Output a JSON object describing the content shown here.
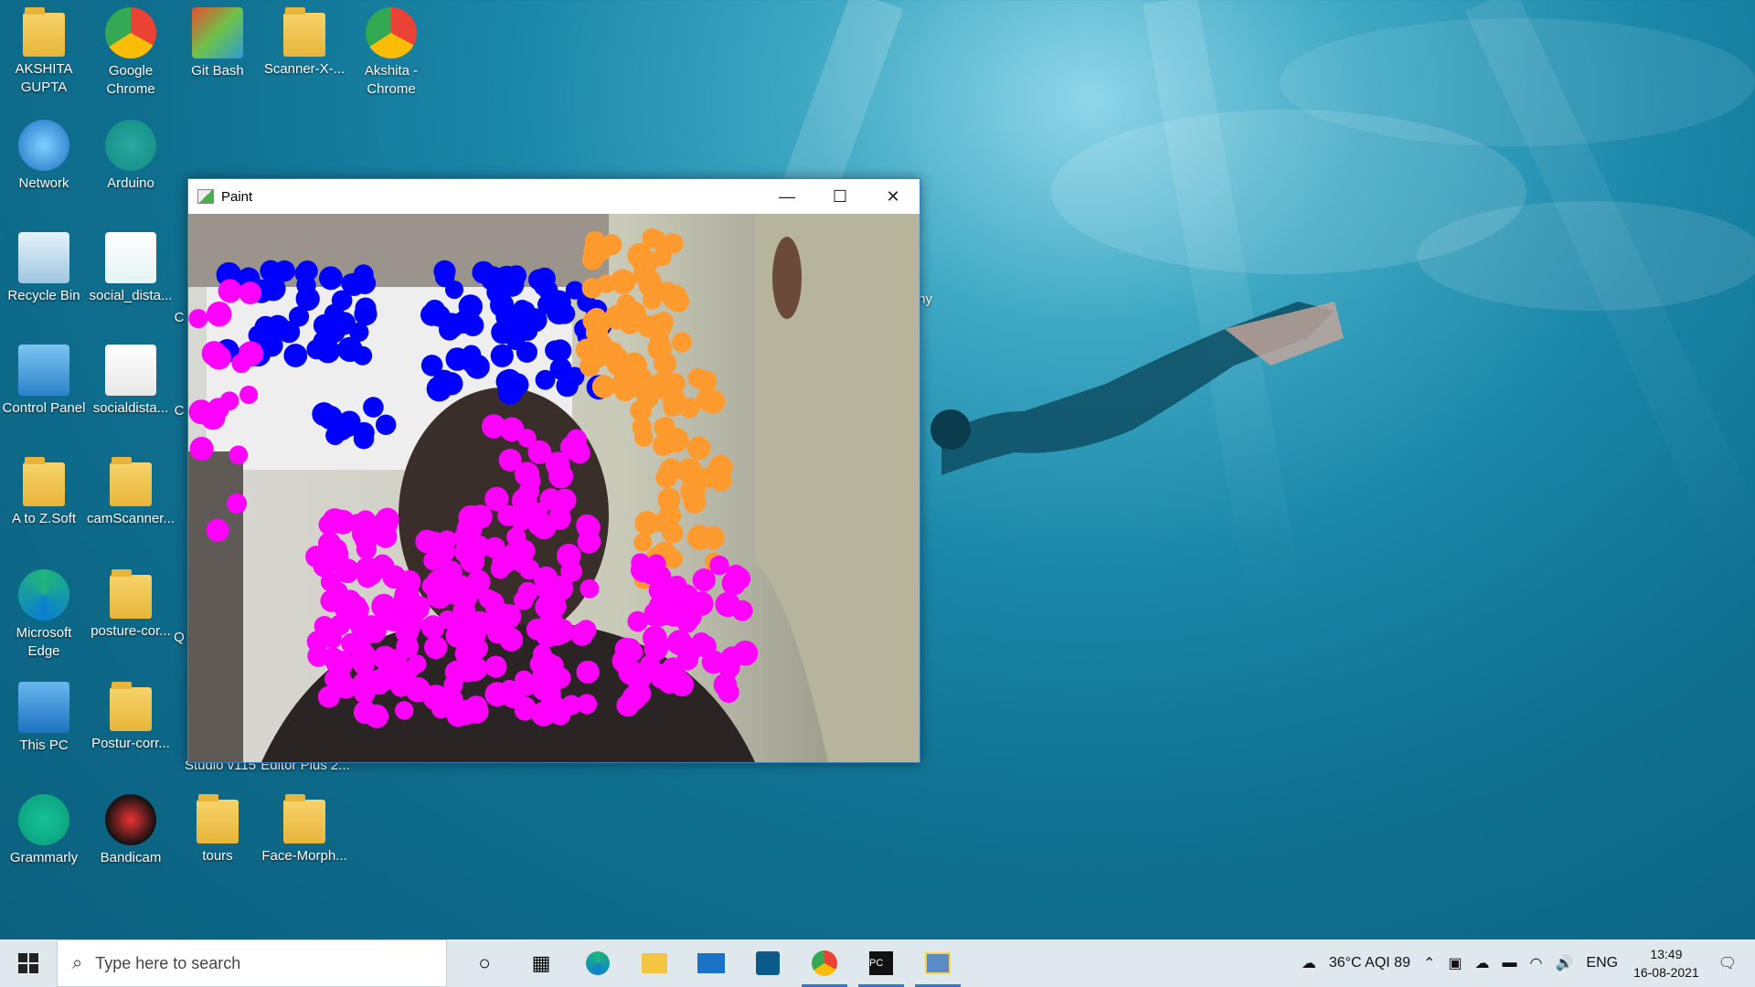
{
  "desktop": {
    "icons": [
      {
        "label": "AKSHITA\nGUPTA",
        "type": "folder-user"
      },
      {
        "label": "Google\nChrome",
        "type": "chrome"
      },
      {
        "label": "Git Bash",
        "type": "git"
      },
      {
        "label": "Scanner-X-...",
        "type": "folder"
      },
      {
        "label": "Akshita -\nChrome",
        "type": "chrome"
      },
      {
        "label": "Network",
        "type": "network"
      },
      {
        "label": "Arduino",
        "type": "arduino"
      },
      {
        "label": "Recycle Bin",
        "type": "recycle"
      },
      {
        "label": "social_dista...",
        "type": "arduino-file"
      },
      {
        "label": "Control Panel",
        "type": "control"
      },
      {
        "label": "socialdista...",
        "type": "file"
      },
      {
        "label": "A to Z.Soft",
        "type": "folder-vlc"
      },
      {
        "label": "camScanner...",
        "type": "folder"
      },
      {
        "label": "Microsoft\nEdge",
        "type": "edge"
      },
      {
        "label": "posture-cor...",
        "type": "folder"
      },
      {
        "label": "This PC",
        "type": "pc"
      },
      {
        "label": "Postur-corr...",
        "type": "folder"
      },
      {
        "label": "Grammarly",
        "type": "grammarly"
      },
      {
        "label": "Bandicam",
        "type": "bandicam"
      },
      {
        "label": "tours",
        "type": "folder"
      },
      {
        "label": "Face-Morph...",
        "type": "folder"
      }
    ],
    "partial_labels": [
      "Studio v115",
      "Editor Plus 2...",
      "my",
      "C",
      "C",
      "C",
      "Q"
    ]
  },
  "window": {
    "title": "Paint",
    "minimize": "—",
    "maximize": "☐",
    "close": "✕"
  },
  "taskbar": {
    "search_placeholder": "Type here to search",
    "weather": "36°C  AQI 89",
    "language": "ENG",
    "time": "13:49",
    "date": "16-08-2021"
  },
  "colors": {
    "blue": "#0000ff",
    "magenta": "#ff00ff",
    "orange": "#ff9a2e"
  }
}
